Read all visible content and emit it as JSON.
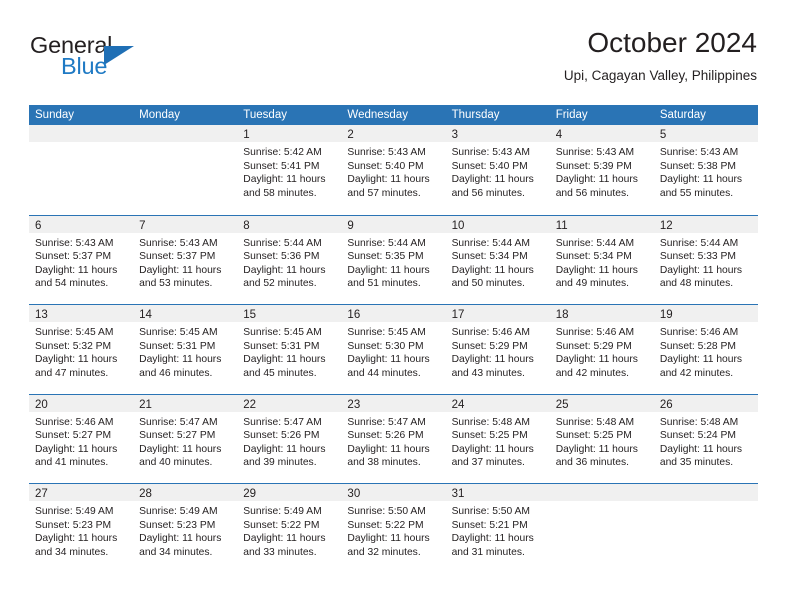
{
  "brand": {
    "logo_text_top": "General",
    "logo_text_bottom": "Blue",
    "logo_color_top": "#231f20",
    "logo_color_bottom": "#1f7ac4",
    "triangle_color": "#1f6fb5",
    "icon": "general-blue-logo"
  },
  "header": {
    "title": "October 2024",
    "subtitle": "Upi, Cagayan Valley, Philippines"
  },
  "theme": {
    "header_blue": "#2a74b5",
    "daynum_band": "#f0f0f0",
    "text": "#231f20"
  },
  "calendar": {
    "day_headers": [
      "Sunday",
      "Monday",
      "Tuesday",
      "Wednesday",
      "Thursday",
      "Friday",
      "Saturday"
    ],
    "weeks": [
      [
        {
          "day": "",
          "lines": []
        },
        {
          "day": "",
          "lines": []
        },
        {
          "day": "1",
          "lines": [
            "Sunrise: 5:42 AM",
            "Sunset: 5:41 PM",
            "Daylight: 11 hours",
            "and 58 minutes."
          ]
        },
        {
          "day": "2",
          "lines": [
            "Sunrise: 5:43 AM",
            "Sunset: 5:40 PM",
            "Daylight: 11 hours",
            "and 57 minutes."
          ]
        },
        {
          "day": "3",
          "lines": [
            "Sunrise: 5:43 AM",
            "Sunset: 5:40 PM",
            "Daylight: 11 hours",
            "and 56 minutes."
          ]
        },
        {
          "day": "4",
          "lines": [
            "Sunrise: 5:43 AM",
            "Sunset: 5:39 PM",
            "Daylight: 11 hours",
            "and 56 minutes."
          ]
        },
        {
          "day": "5",
          "lines": [
            "Sunrise: 5:43 AM",
            "Sunset: 5:38 PM",
            "Daylight: 11 hours",
            "and 55 minutes."
          ]
        }
      ],
      [
        {
          "day": "6",
          "lines": [
            "Sunrise: 5:43 AM",
            "Sunset: 5:37 PM",
            "Daylight: 11 hours",
            "and 54 minutes."
          ]
        },
        {
          "day": "7",
          "lines": [
            "Sunrise: 5:43 AM",
            "Sunset: 5:37 PM",
            "Daylight: 11 hours",
            "and 53 minutes."
          ]
        },
        {
          "day": "8",
          "lines": [
            "Sunrise: 5:44 AM",
            "Sunset: 5:36 PM",
            "Daylight: 11 hours",
            "and 52 minutes."
          ]
        },
        {
          "day": "9",
          "lines": [
            "Sunrise: 5:44 AM",
            "Sunset: 5:35 PM",
            "Daylight: 11 hours",
            "and 51 minutes."
          ]
        },
        {
          "day": "10",
          "lines": [
            "Sunrise: 5:44 AM",
            "Sunset: 5:34 PM",
            "Daylight: 11 hours",
            "and 50 minutes."
          ]
        },
        {
          "day": "11",
          "lines": [
            "Sunrise: 5:44 AM",
            "Sunset: 5:34 PM",
            "Daylight: 11 hours",
            "and 49 minutes."
          ]
        },
        {
          "day": "12",
          "lines": [
            "Sunrise: 5:44 AM",
            "Sunset: 5:33 PM",
            "Daylight: 11 hours",
            "and 48 minutes."
          ]
        }
      ],
      [
        {
          "day": "13",
          "lines": [
            "Sunrise: 5:45 AM",
            "Sunset: 5:32 PM",
            "Daylight: 11 hours",
            "and 47 minutes."
          ]
        },
        {
          "day": "14",
          "lines": [
            "Sunrise: 5:45 AM",
            "Sunset: 5:31 PM",
            "Daylight: 11 hours",
            "and 46 minutes."
          ]
        },
        {
          "day": "15",
          "lines": [
            "Sunrise: 5:45 AM",
            "Sunset: 5:31 PM",
            "Daylight: 11 hours",
            "and 45 minutes."
          ]
        },
        {
          "day": "16",
          "lines": [
            "Sunrise: 5:45 AM",
            "Sunset: 5:30 PM",
            "Daylight: 11 hours",
            "and 44 minutes."
          ]
        },
        {
          "day": "17",
          "lines": [
            "Sunrise: 5:46 AM",
            "Sunset: 5:29 PM",
            "Daylight: 11 hours",
            "and 43 minutes."
          ]
        },
        {
          "day": "18",
          "lines": [
            "Sunrise: 5:46 AM",
            "Sunset: 5:29 PM",
            "Daylight: 11 hours",
            "and 42 minutes."
          ]
        },
        {
          "day": "19",
          "lines": [
            "Sunrise: 5:46 AM",
            "Sunset: 5:28 PM",
            "Daylight: 11 hours",
            "and 42 minutes."
          ]
        }
      ],
      [
        {
          "day": "20",
          "lines": [
            "Sunrise: 5:46 AM",
            "Sunset: 5:27 PM",
            "Daylight: 11 hours",
            "and 41 minutes."
          ]
        },
        {
          "day": "21",
          "lines": [
            "Sunrise: 5:47 AM",
            "Sunset: 5:27 PM",
            "Daylight: 11 hours",
            "and 40 minutes."
          ]
        },
        {
          "day": "22",
          "lines": [
            "Sunrise: 5:47 AM",
            "Sunset: 5:26 PM",
            "Daylight: 11 hours",
            "and 39 minutes."
          ]
        },
        {
          "day": "23",
          "lines": [
            "Sunrise: 5:47 AM",
            "Sunset: 5:26 PM",
            "Daylight: 11 hours",
            "and 38 minutes."
          ]
        },
        {
          "day": "24",
          "lines": [
            "Sunrise: 5:48 AM",
            "Sunset: 5:25 PM",
            "Daylight: 11 hours",
            "and 37 minutes."
          ]
        },
        {
          "day": "25",
          "lines": [
            "Sunrise: 5:48 AM",
            "Sunset: 5:25 PM",
            "Daylight: 11 hours",
            "and 36 minutes."
          ]
        },
        {
          "day": "26",
          "lines": [
            "Sunrise: 5:48 AM",
            "Sunset: 5:24 PM",
            "Daylight: 11 hours",
            "and 35 minutes."
          ]
        }
      ],
      [
        {
          "day": "27",
          "lines": [
            "Sunrise: 5:49 AM",
            "Sunset: 5:23 PM",
            "Daylight: 11 hours",
            "and 34 minutes."
          ]
        },
        {
          "day": "28",
          "lines": [
            "Sunrise: 5:49 AM",
            "Sunset: 5:23 PM",
            "Daylight: 11 hours",
            "and 34 minutes."
          ]
        },
        {
          "day": "29",
          "lines": [
            "Sunrise: 5:49 AM",
            "Sunset: 5:22 PM",
            "Daylight: 11 hours",
            "and 33 minutes."
          ]
        },
        {
          "day": "30",
          "lines": [
            "Sunrise: 5:50 AM",
            "Sunset: 5:22 PM",
            "Daylight: 11 hours",
            "and 32 minutes."
          ]
        },
        {
          "day": "31",
          "lines": [
            "Sunrise: 5:50 AM",
            "Sunset: 5:21 PM",
            "Daylight: 11 hours",
            "and 31 minutes."
          ]
        },
        {
          "day": "",
          "lines": []
        },
        {
          "day": "",
          "lines": []
        }
      ]
    ]
  }
}
